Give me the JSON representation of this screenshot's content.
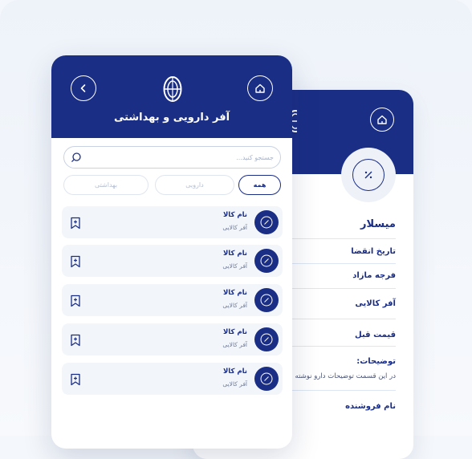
{
  "colors": {
    "brand": "#1b2e86",
    "card": "#f2f6fb",
    "divider": "#dde6f2"
  },
  "list_screen": {
    "title": "آفر دارویی و بهداشتی",
    "search_placeholder": "جستجو کنید...",
    "filters": [
      {
        "label": "همه",
        "active": true
      },
      {
        "label": "دارویی",
        "active": false
      },
      {
        "label": "بهداشتی",
        "active": false
      }
    ],
    "items": [
      {
        "name": "نام کالا",
        "subtitle": "آفر کالایی"
      },
      {
        "name": "نام کالا",
        "subtitle": "آفر کالایی"
      },
      {
        "name": "نام کالا",
        "subtitle": "آفر کالایی"
      },
      {
        "name": "نام کالا",
        "subtitle": "آفر کالایی"
      },
      {
        "name": "نام کالا",
        "subtitle": "آفر کالایی"
      }
    ]
  },
  "detail_screen": {
    "product_name": "میسلار",
    "fields": [
      "تاریخ انقضا",
      "فرجه مازاد",
      "آفر کالایی",
      "قیمت قبل"
    ],
    "description_label": "توضیحات:",
    "description_text": "در این قسمت توضیحات دارو نوشته",
    "seller_label": "نام فروشنده"
  }
}
